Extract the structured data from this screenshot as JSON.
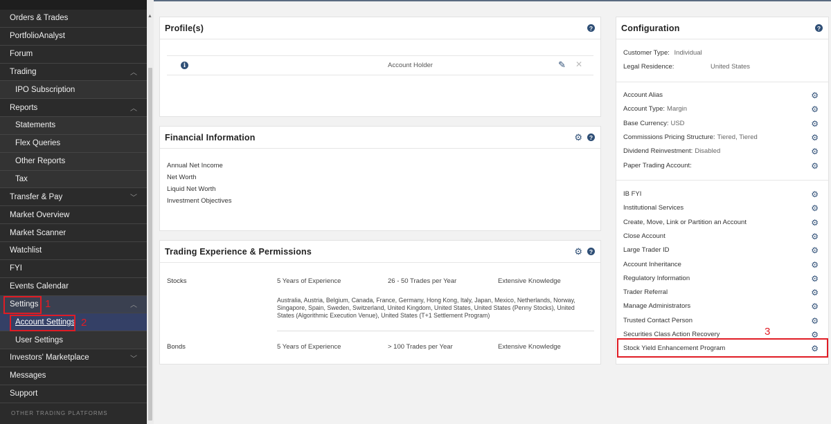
{
  "sidebar": {
    "items": [
      {
        "label": "Orders & Trades",
        "sub": false,
        "chevron": ""
      },
      {
        "label": "PortfolioAnalyst",
        "sub": false,
        "chevron": ""
      },
      {
        "label": "Forum",
        "sub": false,
        "chevron": ""
      },
      {
        "label": "Trading",
        "sub": false,
        "chevron": "up"
      },
      {
        "label": "IPO Subscription",
        "sub": true,
        "chevron": ""
      },
      {
        "label": "Reports",
        "sub": false,
        "chevron": "up"
      },
      {
        "label": "Statements",
        "sub": true,
        "chevron": ""
      },
      {
        "label": "Flex Queries",
        "sub": true,
        "chevron": ""
      },
      {
        "label": "Other Reports",
        "sub": true,
        "chevron": ""
      },
      {
        "label": "Tax",
        "sub": true,
        "chevron": ""
      },
      {
        "label": "Transfer & Pay",
        "sub": false,
        "chevron": "down"
      },
      {
        "label": "Market Overview",
        "sub": false,
        "chevron": ""
      },
      {
        "label": "Market Scanner",
        "sub": false,
        "chevron": ""
      },
      {
        "label": "Watchlist",
        "sub": false,
        "chevron": ""
      },
      {
        "label": "FYI",
        "sub": false,
        "chevron": ""
      },
      {
        "label": "Events Calendar",
        "sub": false,
        "chevron": ""
      },
      {
        "label": "Settings",
        "sub": false,
        "chevron": "up",
        "state": "active-parent"
      },
      {
        "label": "Account Settings",
        "sub": true,
        "chevron": "",
        "state": "active-sub"
      },
      {
        "label": "User Settings",
        "sub": true,
        "chevron": ""
      },
      {
        "label": "Investors' Marketplace",
        "sub": false,
        "chevron": "down"
      },
      {
        "label": "Messages",
        "sub": false,
        "chevron": ""
      },
      {
        "label": "Support",
        "sub": false,
        "chevron": ""
      }
    ],
    "footer": "OTHER TRADING PLATFORMS"
  },
  "annotations": {
    "n1": "1",
    "n2": "2",
    "n3": "3"
  },
  "profile": {
    "title": "Profile(s)",
    "role": "Account Holder"
  },
  "financial": {
    "title": "Financial Information",
    "items": [
      "Annual Net Income",
      "Net Worth",
      "Liquid Net Worth",
      "Investment Objectives"
    ]
  },
  "trading": {
    "title": "Trading Experience & Permissions",
    "rows": [
      {
        "asset": "Stocks",
        "experience": "5 Years of Experience",
        "trades": "26 - 50 Trades per Year",
        "knowledge": "Extensive Knowledge",
        "markets": "Australia, Austria, Belgium, Canada, France, Germany, Hong Kong, Italy, Japan, Mexico, Netherlands, Norway, Singapore, Spain, Sweden, Switzerland, United Kingdom, United States, United States (Penny Stocks), United States (Algorithmic Execution Venue), United States (T+1 Settlement Program)"
      },
      {
        "asset": "Bonds",
        "experience": "5 Years of Experience",
        "trades": "> 100 Trades per Year",
        "knowledge": "Extensive Knowledge",
        "markets": ""
      }
    ]
  },
  "config": {
    "title": "Configuration",
    "customer_type_label": "Customer Type:",
    "customer_type_value": "Individual",
    "legal_residence_label": "Legal Residence:",
    "legal_residence_value": "United States",
    "group1": [
      {
        "label": "Account Alias",
        "value": ""
      },
      {
        "label": "Account Type:",
        "value": "Margin"
      },
      {
        "label": "Base Currency:",
        "value": "USD"
      },
      {
        "label": "Commissions Pricing Structure:",
        "value": "Tiered, Tiered"
      },
      {
        "label": "Dividend Reinvestment:",
        "value": "Disabled"
      },
      {
        "label": "Paper Trading Account:",
        "value": ""
      }
    ],
    "group2": [
      {
        "label": "IB FYI"
      },
      {
        "label": "Institutional Services"
      },
      {
        "label": "Create, Move, Link or Partition an Account"
      },
      {
        "label": "Close Account"
      },
      {
        "label": "Large Trader ID"
      },
      {
        "label": "Account Inheritance"
      },
      {
        "label": "Regulatory Information"
      },
      {
        "label": "Trader Referral"
      },
      {
        "label": "Manage Administrators"
      },
      {
        "label": "Trusted Contact Person"
      },
      {
        "label": "Securities Class Action Recovery"
      },
      {
        "label": "Stock Yield Enhancement Program"
      }
    ]
  },
  "colors": {
    "accent": "#2f4f76",
    "annotation": "#e01c24",
    "sidebar_bg": "#2b2b2b"
  }
}
